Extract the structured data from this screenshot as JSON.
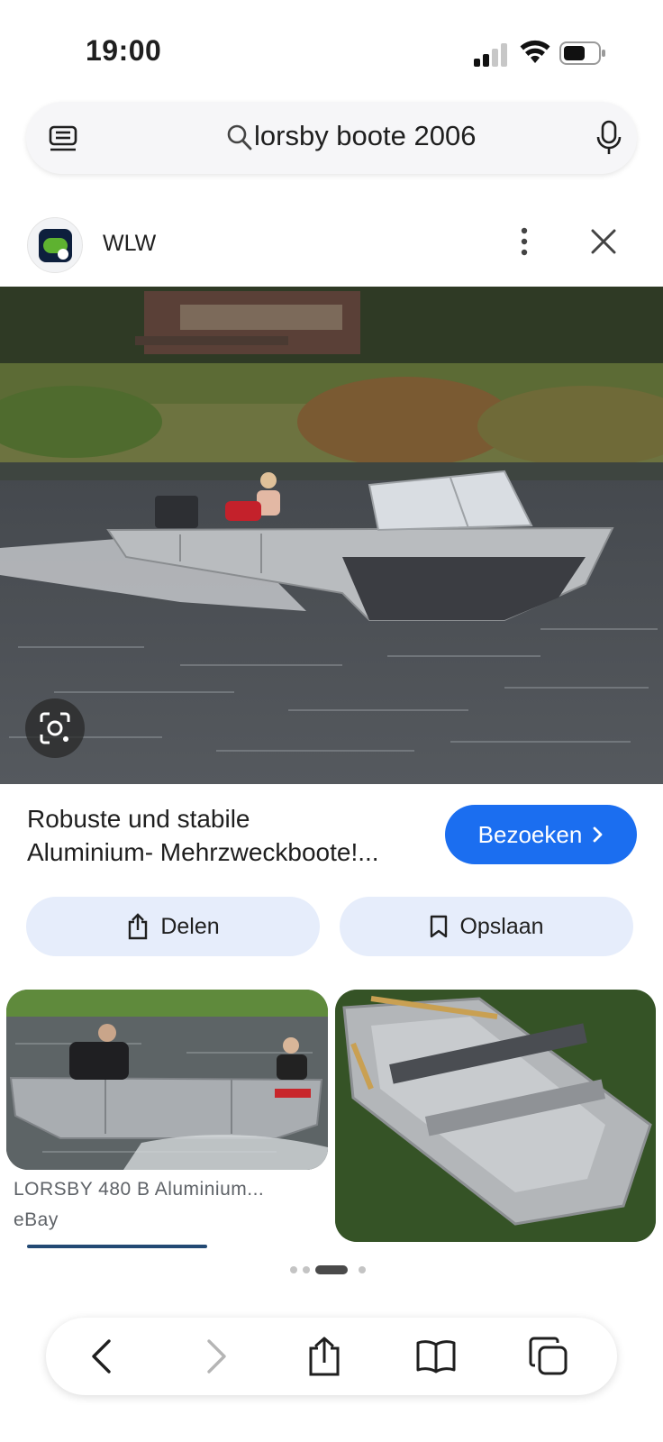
{
  "status_bar": {
    "time": "19:00",
    "icons": [
      "signal-icon",
      "wifi-icon",
      "battery-icon"
    ]
  },
  "search": {
    "query": "lorsby boote 2006",
    "icons": [
      "lens-icon",
      "search-icon",
      "mic-icon"
    ]
  },
  "source": {
    "name": "WLW",
    "logo_colors": {
      "background": "#0d1f3d",
      "accent": "#5eb230"
    },
    "icons": [
      "more-icon",
      "close-icon"
    ]
  },
  "result": {
    "caption_line1": "Robuste und stabile",
    "caption_line2": "Aluminium- Mehrzweckboote!...",
    "visit_label": "Bezoeken",
    "share_label": "Delen",
    "save_label": "Opslaan",
    "accent_color": "#1b6ef0",
    "action_bg": "#e6edfb"
  },
  "related": [
    {
      "title": "LORSBY 480 B Aluminium...",
      "source": "eBay"
    },
    {
      "title": "",
      "source": ""
    }
  ],
  "pager": {
    "total": 4,
    "active": 2
  },
  "toolbar": {
    "icons": [
      "back-icon",
      "forward-icon",
      "share-icon",
      "bookmarks-icon",
      "tabs-icon"
    ]
  }
}
